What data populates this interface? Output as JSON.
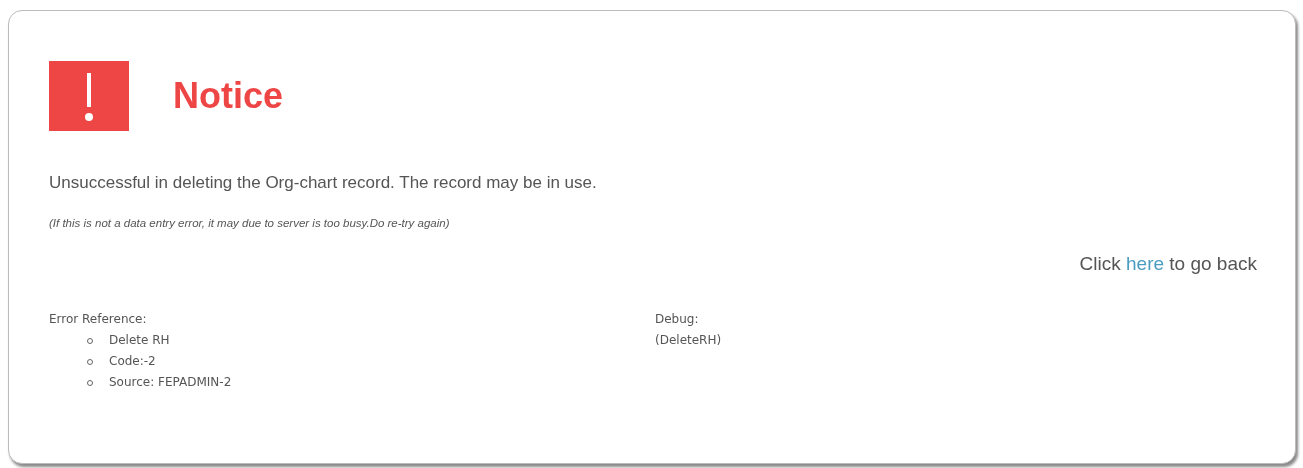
{
  "notice": {
    "title": "Notice",
    "message": "Unsuccessful in deleting the Org-chart record. The record may be in use.",
    "note": "(If this is not a data entry error, it may due to server is too busy.Do re-try again)",
    "back": {
      "before": "Click",
      "link": "here",
      "after": "to go back"
    },
    "error_reference": {
      "label": "Error Reference:",
      "items": [
        "Delete RH",
        "Code:-2",
        "Source: FEPADMIN-2"
      ]
    },
    "debug": {
      "label": "Debug:",
      "value": "(DeleteRH)"
    }
  }
}
